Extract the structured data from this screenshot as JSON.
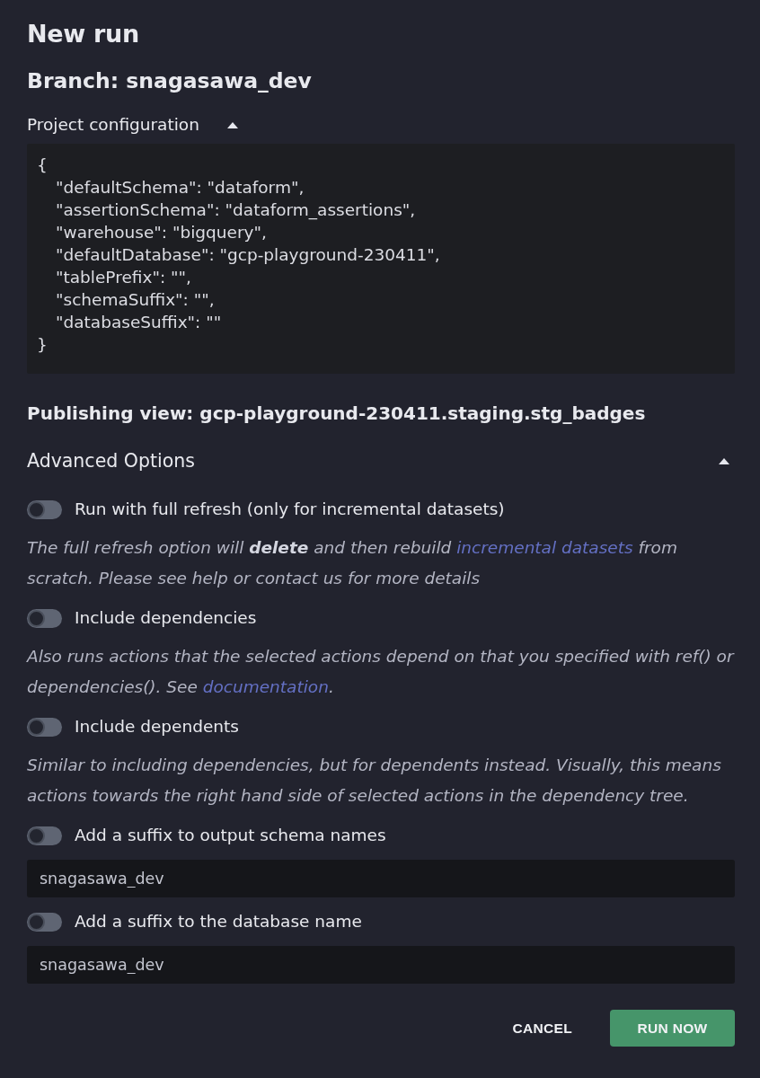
{
  "dialog": {
    "title": "New run",
    "branch": "Branch: snagasawa_dev"
  },
  "project_configuration": {
    "label": "Project configuration",
    "expanded": true,
    "code": {
      "open": "{",
      "entries": [
        "\"defaultSchema\": \"dataform\",",
        "\"assertionSchema\": \"dataform_assertions\",",
        "\"warehouse\": \"bigquery\",",
        "\"defaultDatabase\": \"gcp-playground-230411\",",
        "\"tablePrefix\": \"\",",
        "\"schemaSuffix\": \"\",",
        "\"databaseSuffix\": \"\""
      ],
      "close": "}"
    }
  },
  "publishing_view": "Publishing view: gcp-playground-230411.staging.stg_badges",
  "advanced_options": {
    "label": "Advanced Options",
    "expanded": true,
    "options": [
      {
        "kind": "toggle",
        "label": "Run with full refresh (only for incremental datasets)",
        "on": false,
        "description": [
          {
            "kind": "text",
            "text": "The full refresh option will **delete** and then rebuild "
          },
          {
            "kind": "link",
            "text": "incremental datasets"
          },
          {
            "kind": "text",
            "text": " from scratch. Please see help or contact us for more details"
          }
        ]
      },
      {
        "kind": "toggle",
        "label": "Include dependencies",
        "on": false,
        "description": [
          {
            "kind": "text",
            "text": "Also runs actions that the selected actions depend on that you specified with ref() or dependencies(). See "
          },
          {
            "kind": "link",
            "text": "documentation"
          },
          {
            "kind": "text",
            "text": "."
          }
        ]
      },
      {
        "kind": "toggle",
        "label": "Include dependents",
        "on": false,
        "description": [
          {
            "kind": "text",
            "text": "Similar to including dependencies, but for dependents instead. Visually, this means actions towards the right hand side of selected actions in the dependency tree."
          }
        ]
      },
      {
        "kind": "toggle_field",
        "label": "Add a suffix to output schema names",
        "on": false,
        "value": "snagasawa_dev"
      },
      {
        "kind": "toggle_field",
        "label": "Add a suffix to the database name",
        "on": false,
        "value": "snagasawa_dev"
      }
    ]
  },
  "buttons": [
    {
      "kind": "text",
      "label": "CANCEL"
    },
    {
      "kind": "primary",
      "label": "RUN NOW"
    }
  ]
}
